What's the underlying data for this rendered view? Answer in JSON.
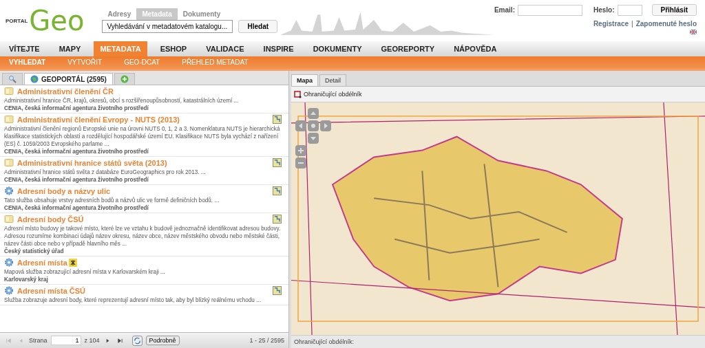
{
  "header": {
    "logo_small": "PORTAL",
    "logo_big": "Geo",
    "search_tabs": [
      {
        "label": "Adresy",
        "selected": false
      },
      {
        "label": "Metadata",
        "selected": true
      },
      {
        "label": "Dokumenty",
        "selected": false
      }
    ],
    "search_value": "Vyhledávání v metadatovém katalogu...",
    "search_button": "Hledat",
    "email_label": "Email:",
    "password_label": "Heslo:",
    "login_button": "Přihlásit",
    "register_link": "Registrace",
    "separator": "|",
    "forgot_link": "Zapomenuté heslo"
  },
  "nav": [
    {
      "label": "VÍTEJTE",
      "selected": false
    },
    {
      "label": "MAPY",
      "selected": false
    },
    {
      "label": "METADATA",
      "selected": true
    },
    {
      "label": "ESHOP",
      "selected": false
    },
    {
      "label": "VALIDACE",
      "selected": false
    },
    {
      "label": "INSPIRE",
      "selected": false
    },
    {
      "label": "DOKUMENTY",
      "selected": false
    },
    {
      "label": "GEOREPORTY",
      "selected": false
    },
    {
      "label": "NÁPOVĚDA",
      "selected": false
    }
  ],
  "subnav": [
    {
      "label": "VYHLEDAT",
      "selected": true
    },
    {
      "label": "VYTVOŘIT",
      "selected": false
    },
    {
      "label": "GEO-DCAT",
      "selected": false
    },
    {
      "label": "PŘEHLED METADAT",
      "selected": false
    }
  ],
  "left_tabs": [
    {
      "kind": "search",
      "selected": false
    },
    {
      "kind": "catalog",
      "label": "GEOPORTÁL (2595)",
      "selected": true
    },
    {
      "kind": "add",
      "selected": false
    }
  ],
  "results": [
    {
      "kind": "dataset",
      "title": "Administrativní členění ČR",
      "map_link": false,
      "title_badge": false,
      "description": "Administrativní hranice ČR, krajů, okresů, obcí s rozšířenoupůsobností, katastrálních území ...",
      "organization": "CENIA, česká informační agentura životního prostředí"
    },
    {
      "kind": "dataset",
      "title": "Administrativní členění Evropy - NUTS (2013)",
      "map_link": true,
      "title_badge": false,
      "description": "Administrativní členění regionů Evropské unie na úrovni NUTS 0, 1, 2 a 3. Nomenklatura NUTS je hierarchická klasifikace statistických oblastí a rozdělující hospodářské území EU. Klasifikace NUTS byla vychází z nařízení (ES) č. 1059/2003 Evropského parlame ...",
      "organization": "CENIA, česká informační agentura životního prostředí"
    },
    {
      "kind": "dataset",
      "title": "Administrativní hranice států světa (2013)",
      "map_link": true,
      "title_badge": false,
      "description": "Administrativní hranice států světa z databáze EuroGeographics pro rok 2013. ...",
      "organization": "CENIA, česká informační agentura životního prostředí"
    },
    {
      "kind": "service",
      "title": "Adresní body a názvy ulic",
      "map_link": true,
      "title_badge": false,
      "description": "Tato služba obsahuje vrstvy adresních bodů a názvů ulic ve formě definičních bodů. ...",
      "organization": "CENIA, česká informační agentura životního prostředí"
    },
    {
      "kind": "dataset",
      "title": "Adresní body ČSÚ",
      "map_link": true,
      "title_badge": false,
      "description": "Adresní místo budovy je takové místo, které lze ve vztahu k budově jednoznačně identifikovat adresou budovy. Adresou rozumíme kombinaci údajů název okresu, název obce, název městského obvodu nebo městské části, název části obce nebo v případě hlavního měs ...",
      "organization": "Český statistický úřad"
    },
    {
      "kind": "service",
      "title": "Adresní místa",
      "map_link": false,
      "title_badge": true,
      "description": "Mapová služba zobrazující adresní místa v Karlovarském kraji ...",
      "organization": "Karlovarský kraj"
    },
    {
      "kind": "service",
      "title": "Adresní místa ČSÚ",
      "map_link": true,
      "title_badge": false,
      "description": "Služba zobrazuje adresní body, které reprezentují adresní místo tak, aby byl blízký reálnému vchodu ..."
    }
  ],
  "pager": {
    "page_label": "Strana",
    "page": "1",
    "of": "z 104",
    "details_button": "Podrobně",
    "range": "1 - 25 / 2595"
  },
  "right_tabs": [
    {
      "label": "Mapa",
      "selected": true
    },
    {
      "label": "Detail",
      "selected": false
    }
  ],
  "map_tool": "Ohraničující obdélník",
  "status": "Ohraničující obdélník:"
}
